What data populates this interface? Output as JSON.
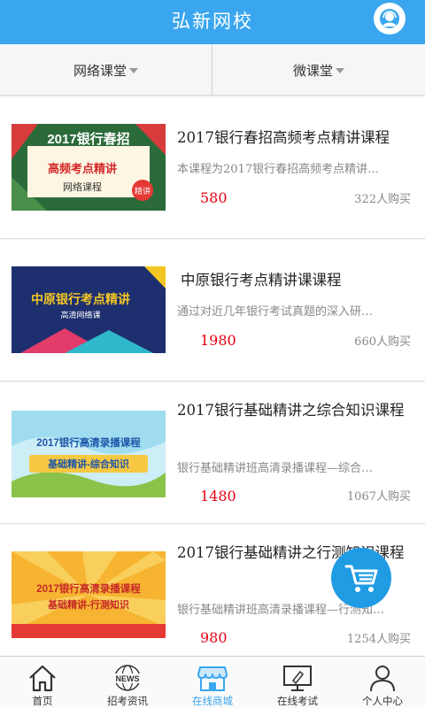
{
  "header": {
    "title": "弘新网校",
    "service_icon": "customer-service-icon"
  },
  "filters": {
    "left": "网络课堂",
    "right": "微课堂"
  },
  "courses": [
    {
      "thumb": {
        "line1": "2017银行春招",
        "line2": "高频考点精讲",
        "line3": "网络课程",
        "stamp": "精讲"
      },
      "title": "2017银行春招高频考点精讲课程",
      "desc": "本课程为2017银行春招高频考点精讲…",
      "price": "580",
      "buyers": "322人购买"
    },
    {
      "thumb": {
        "line1": "中原银行考点精讲",
        "line2": "高清网络课"
      },
      "title": "中原银行考点精讲课课程",
      "desc": "通过对近几年银行考试真题的深入研…",
      "price": "1980",
      "buyers": "660人购买"
    },
    {
      "thumb": {
        "line1": "2017银行高清录播课程",
        "line2": "基础精讲-综合知识"
      },
      "title": "2017银行基础精讲之综合知识课程",
      "desc": "银行基础精讲班高清录播课程—综合…",
      "price": "1480",
      "buyers": "1067人购买"
    },
    {
      "thumb": {
        "line1": "2017银行高清录播课程",
        "line2": "基础精讲-行测知识"
      },
      "title": "2017银行基础精讲之行测知识课程",
      "desc": "银行基础精讲班高清录播课程—行测知…",
      "price": "980",
      "buyers": "1254人购买"
    }
  ],
  "tabbar": [
    {
      "label": "首页",
      "icon": "home-icon"
    },
    {
      "label": "招考资讯",
      "icon": "news-icon",
      "icon_text": "NEWS"
    },
    {
      "label": "在线商城",
      "icon": "store-icon",
      "active": true
    },
    {
      "label": "在线考试",
      "icon": "exam-monitor-icon"
    },
    {
      "label": "个人中心",
      "icon": "user-icon"
    }
  ],
  "colors": {
    "primary": "#3aa6ef",
    "price": "#e60012",
    "fab": "#1f9ce4"
  }
}
